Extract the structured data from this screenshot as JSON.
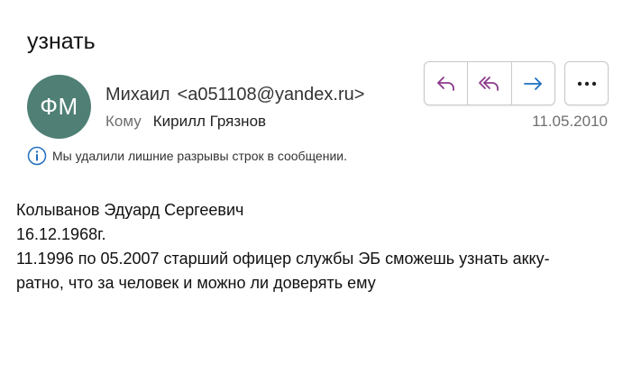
{
  "subject": "узнать",
  "avatar": {
    "initials": "ФМ",
    "color": "#4f7f75"
  },
  "sender": {
    "name": "Михаил",
    "email": "<a051108@yandex.ru>"
  },
  "recipient": {
    "label": "Кому",
    "name": "Кирилл Грязнов"
  },
  "date": "11.05.2010",
  "toolbar": {
    "accent": "#8b3a8b",
    "forward_color": "#1f6fbf"
  },
  "notice": "Мы удалили лишние разрывы строк в сообщении.",
  "body": {
    "lines": [
      "Колыванов Эдуард Сергеевич",
      "16.12.1968г.",
      "11.1996 по 05.2007 старший офицер службы ЭБ сможешь узнать акку-",
      "ратно, что за человек и можно ли доверять ему"
    ]
  }
}
